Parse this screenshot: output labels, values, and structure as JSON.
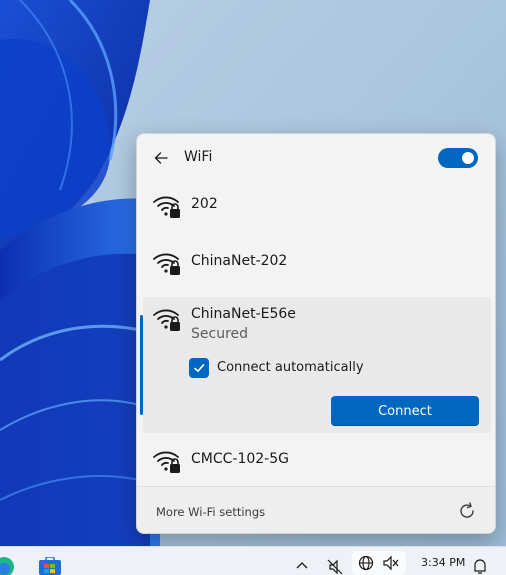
{
  "panel": {
    "title": "WiFi",
    "wifi_enabled": true,
    "accent_color": "#0067c0",
    "back_icon": "arrow-left-icon"
  },
  "networks": [
    {
      "name": "202",
      "secured": true
    },
    {
      "name": "ChinaNet-202",
      "secured": true
    },
    {
      "name": "ChinaNet-E56e",
      "status": "Secured",
      "secured": true,
      "selected": true,
      "connect_automatically_label": "Connect automatically",
      "connect_automatically": true,
      "connect_button": "Connect"
    },
    {
      "name": "CMCC-102-5G",
      "secured": true
    }
  ],
  "footer": {
    "more_settings": "More Wi-Fi settings",
    "refresh_icon": "refresh-icon"
  },
  "taskbar": {
    "time": "3:34 PM",
    "icons": [
      "edge-icon",
      "store-icon",
      "chevron-up-icon",
      "mute-icon",
      "globe-icon",
      "volume-icon",
      "notification-icon"
    ]
  }
}
